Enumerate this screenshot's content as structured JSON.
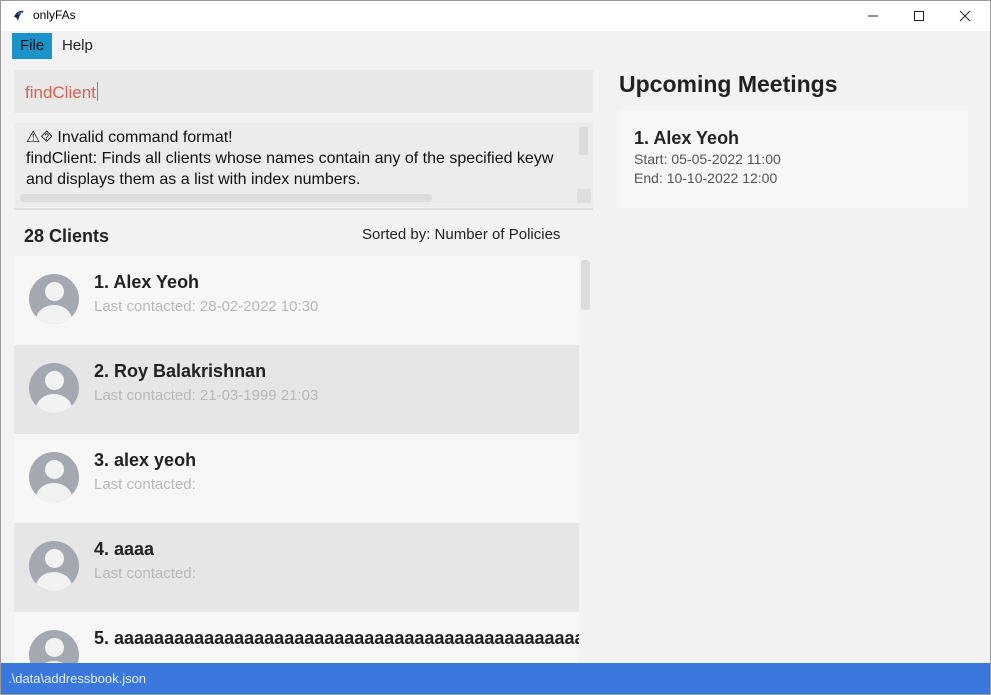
{
  "window": {
    "title": "onlyFAs"
  },
  "menu": {
    "file": "File",
    "help": "Help"
  },
  "command": {
    "value": "findClient"
  },
  "result": {
    "text": "⚠⯑ Invalid command format!\nfindClient: Finds all clients whose names contain any of the specified keyw\nand displays them as a list with index numbers."
  },
  "clients": {
    "count_label": "28 Clients",
    "sorted_label": "Sorted by: Number of Policies",
    "items": [
      {
        "name": "1.  Alex Yeoh",
        "contact": "Last contacted: 28-02-2022 10:30"
      },
      {
        "name": "2.  Roy Balakrishnan",
        "contact": "Last contacted: 21-03-1999 21:03"
      },
      {
        "name": "3.  alex yeoh",
        "contact": "Last contacted:"
      },
      {
        "name": "4.  aaaa",
        "contact": "Last contacted:"
      },
      {
        "name": "5.  aaaaaaaaaaaaaaaaaaaaaaaaaaaaaaaaaaaaaaaaaaaaaaa...",
        "contact": ""
      }
    ]
  },
  "meetings": {
    "title": "Upcoming Meetings",
    "items": [
      {
        "name": "1.  Alex Yeoh",
        "start": "Start: 05-05-2022 11:00",
        "end": "End: 10-10-2022 12:00"
      }
    ]
  },
  "status": {
    "path": ".\\data\\addressbook.json"
  },
  "colors": {
    "accent": "#1a93c9",
    "status_bar": "#3a78de",
    "command_text": "#d9614f"
  },
  "icons": {
    "app": "app-logo-icon",
    "avatar": "user-avatar-icon"
  }
}
